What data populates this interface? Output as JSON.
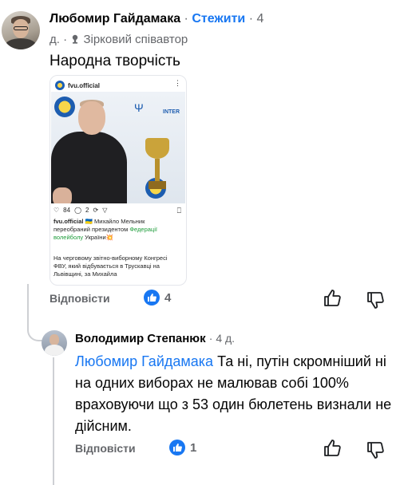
{
  "comment": {
    "author": "Любомир Гайдамака",
    "separator": "·",
    "follow_label": "Стежити",
    "time_part1": "· 4",
    "time_part2": "д.",
    "badge_separator": "·",
    "badge_label": "Зірковий співавтор",
    "text": "Народна творчість",
    "reply_label": "Відповісти",
    "like_count": "4"
  },
  "embedded_post": {
    "username": "fvu.official",
    "likes": "84",
    "comments": "2",
    "caption_user": "fvu.official",
    "caption_line1": "🇺🇦 Михайло Мельник",
    "caption_line2a": "переобраний президентом ",
    "caption_highlight": "Федерації",
    "caption_line3a": "волейболу",
    "caption_line3b": " України💥",
    "caption_p2": "На черговому звітно-виборному Конгресі ФВУ, який відбувається в Трускавці на Львівщині, за Михайла",
    "banner_text": "INTER"
  },
  "reply": {
    "author": "Володимир Степанюк",
    "time": "· 4 д.",
    "mention": "Любомир Гайдамака",
    "text": " Та ні, путін скромніший ні на одних виборах не малював собі 100% враховуючи що з 53 один бюлетень визнали не дійсним.",
    "reply_label": "Відповісти",
    "like_count": "1"
  },
  "colors": {
    "accent": "#1877f2",
    "muted": "#65676b"
  }
}
